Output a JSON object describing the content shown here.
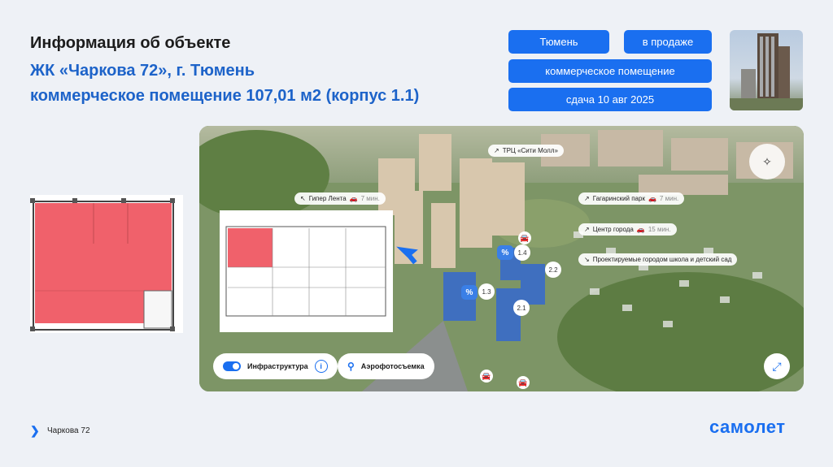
{
  "header": {
    "title": "Информация об объекте",
    "complex": "ЖК «Чаркова 72», г. Тюмень",
    "unit": "коммерческое помещение 107,01 м2 (корпус 1.1)"
  },
  "tags": {
    "city": "Тюмень",
    "status": "в продаже",
    "type": "коммерческое помещение",
    "delivery": "сдача 10 авг 2025"
  },
  "map": {
    "labels": {
      "mall": "ТРЦ «Сити Молл»",
      "lenta": "Гипер Лента",
      "lenta_time": "7 мин.",
      "park": "Гагаринский парк",
      "park_time": "7 мин.",
      "center": "Центр города",
      "center_time": "15 мин.",
      "school": "Проектируемые городом школа и детский сад"
    },
    "buildings": {
      "b13": "1.3",
      "b14": "1.4",
      "b21": "2.1",
      "b22": "2.2",
      "percent": "%"
    },
    "controls": {
      "infra_label": "Инфраструктура",
      "aerial_label": "Аэрофотосъемка",
      "infra_on": true
    }
  },
  "footer": {
    "project": "Чаркова 72",
    "brand": "самолет"
  },
  "colors": {
    "accent": "#1a6ff0",
    "title_blue": "#1d63c9",
    "unit_highlight": "#f0616b",
    "background": "#eef1f6"
  }
}
